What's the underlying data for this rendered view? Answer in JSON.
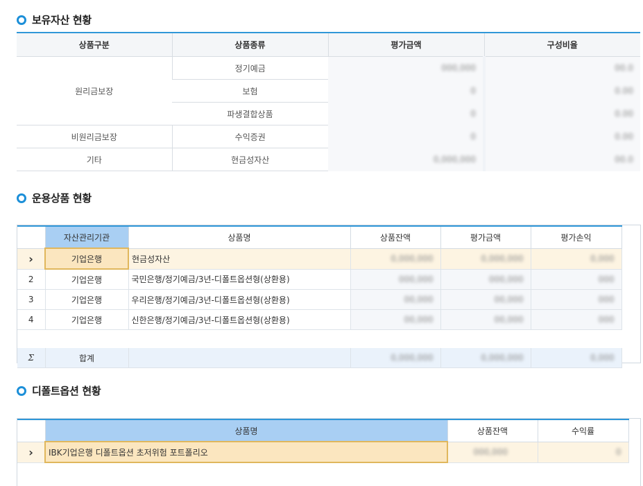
{
  "sections": {
    "holdings_title": "보유자산 현황",
    "products_title": "운용상품 현황",
    "default_title": "디폴트옵션 현황"
  },
  "holdings": {
    "headers": [
      "상품구분",
      "상품종류",
      "평가금액",
      "구성비율"
    ],
    "group_principal": "원리금보장",
    "group_nonprincipal": "비원리금보장",
    "group_other": "기타",
    "rows": [
      {
        "kind": "정기예금",
        "amount": "000,000",
        "ratio": "00.0"
      },
      {
        "kind": "보험",
        "amount": "0",
        "ratio": "0.00"
      },
      {
        "kind": "파생결합상품",
        "amount": "0",
        "ratio": "0.00"
      },
      {
        "kind": "수익증권",
        "amount": "0",
        "ratio": "0.00"
      },
      {
        "kind": "현금성자산",
        "amount": "0,000,000",
        "ratio": "00.0"
      }
    ]
  },
  "products": {
    "headers": [
      "자산관리기관",
      "상품명",
      "상품잔액",
      "평가금액",
      "평가손익"
    ],
    "rows": [
      {
        "no": "›",
        "org": "기업은행",
        "name": "현금성자산",
        "balance": "0,000,000",
        "eval": "0,000,000",
        "pl": "0,000"
      },
      {
        "no": "2",
        "org": "기업은행",
        "name": "국민은행/정기예금/3년-디폴트옵션형(상환용)",
        "balance": "000,000",
        "eval": "000,000",
        "pl": "000"
      },
      {
        "no": "3",
        "org": "기업은행",
        "name": "우리은행/정기예금/3년-디폴트옵션형(상환용)",
        "balance": "00,000",
        "eval": "00,000",
        "pl": "000"
      },
      {
        "no": "4",
        "org": "기업은행",
        "name": "신한은행/정기예금/3년-디폴트옵션형(상환용)",
        "balance": "00,000",
        "eval": "00,000",
        "pl": "000"
      }
    ],
    "sum_symbol": "Σ",
    "sum_label": "합계",
    "sum_balance": "0,000,000",
    "sum_eval": "0,000,000",
    "sum_pl": "0,000"
  },
  "default_option": {
    "headers": [
      "상품명",
      "상품잔액",
      "수익률"
    ],
    "rows": [
      {
        "no": "›",
        "name": "IBK기업은행 디폴트옵션 초저위험 포트폴리오",
        "balance": "000,000",
        "rate": "0"
      }
    ]
  }
}
